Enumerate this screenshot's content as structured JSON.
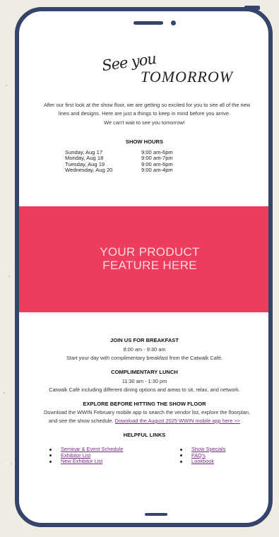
{
  "logo": {
    "script": "See you",
    "main": "TOMORROW"
  },
  "intro": {
    "line1": "After our first look at the show floor, we are getting so excited for you to see all of the new",
    "line2": "lines and designs. Here are just a things to keep in mind before you arrive.",
    "line3": "We can't wait to see you tomorrow!"
  },
  "show_hours": {
    "heading": "SHOW HOURS",
    "rows": [
      {
        "day": "Sunday, Aug 17",
        "time": "9:00 am-6pm"
      },
      {
        "day": "Monday, Aug 18",
        "time": "9:00 am-7pm"
      },
      {
        "day": "Tuesday, Aug 19",
        "time": "9:00 am-6pm"
      },
      {
        "day": "Wednesday, Aug 20",
        "time": "9:00 am-4pm"
      }
    ]
  },
  "banner": {
    "line1": "YOUR PRODUCT",
    "line2": "FEATURE HERE"
  },
  "breakfast": {
    "heading": "JOIN US FOR BREAKFAST",
    "time": "8:00 am - 9:30 am",
    "desc": "Start your day with complimentary breakfast from the Catwalk Café."
  },
  "lunch": {
    "heading": "COMPLIMENTARY LUNCH",
    "time": "11:30 am - 1:30 pm",
    "desc": "Catwalk Café including different dining options and areas to sit, relax, and network."
  },
  "explore": {
    "heading": "EXPLORE BEFORE HITTING THE SHOW FLOOR",
    "line1": "Download the WWIN February mobile app to search the vendor list, explore the floorplan,",
    "line2": "and see the show schedule.",
    "link": "Download the August 2025 WWIN mobile app here >>"
  },
  "helpful": {
    "heading": "HELPFUL LINKS",
    "left": [
      "Seminar & Event Schedule",
      "Exhibitor List",
      "New Exhibitor List"
    ],
    "right": [
      "Show Specials",
      "FAQ's",
      "Lookbook"
    ]
  }
}
